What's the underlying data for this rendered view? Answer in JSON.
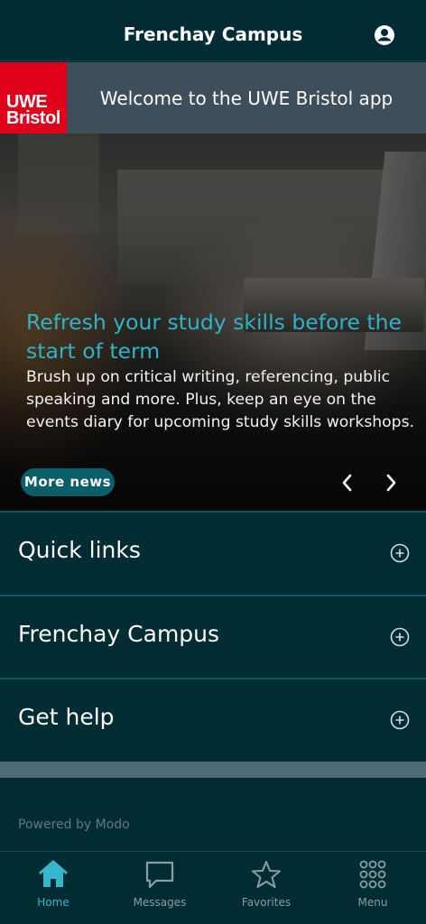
{
  "header": {
    "title": "Frenchay Campus",
    "account_icon": "account-circle-icon"
  },
  "welcome": {
    "logo_line1": "UWE",
    "logo_line2": "Bristol",
    "text": "Welcome to the UWE Bristol app",
    "logo_color": "#e1001a"
  },
  "news": {
    "headline": "Refresh your study skills before the start of term",
    "body": "Brush up on critical writing, referencing, public speaking and more. Plus, keep an eye on the events diary for upcoming study skills workshops.",
    "more_label": "More news",
    "accent": "#2fb3c6"
  },
  "sections": [
    {
      "label": "Quick links"
    },
    {
      "label": "Frenchay Campus"
    },
    {
      "label": "Get help"
    }
  ],
  "footer": {
    "powered_by": "Powered by Modo"
  },
  "tabs": [
    {
      "label": "Home",
      "icon": "home-icon",
      "active": true
    },
    {
      "label": "Messages",
      "icon": "messages-icon"
    },
    {
      "label": "Favorites",
      "icon": "star-icon"
    },
    {
      "label": "Menu",
      "icon": "grid-menu-icon"
    }
  ]
}
